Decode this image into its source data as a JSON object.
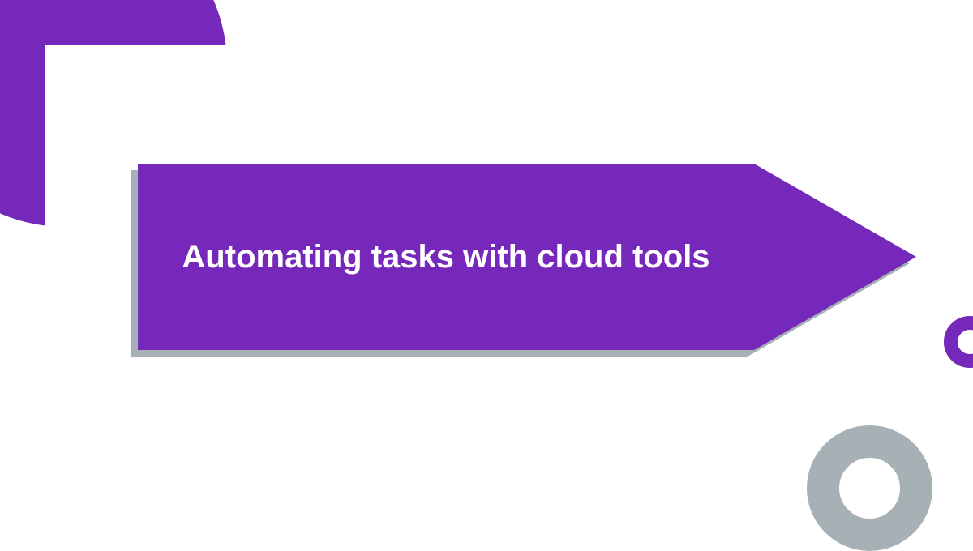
{
  "title": "Automating tasks with cloud tools",
  "colors": {
    "primary": "#7528b9",
    "shadow": "#a7b0b5",
    "background": "#ffffff"
  }
}
